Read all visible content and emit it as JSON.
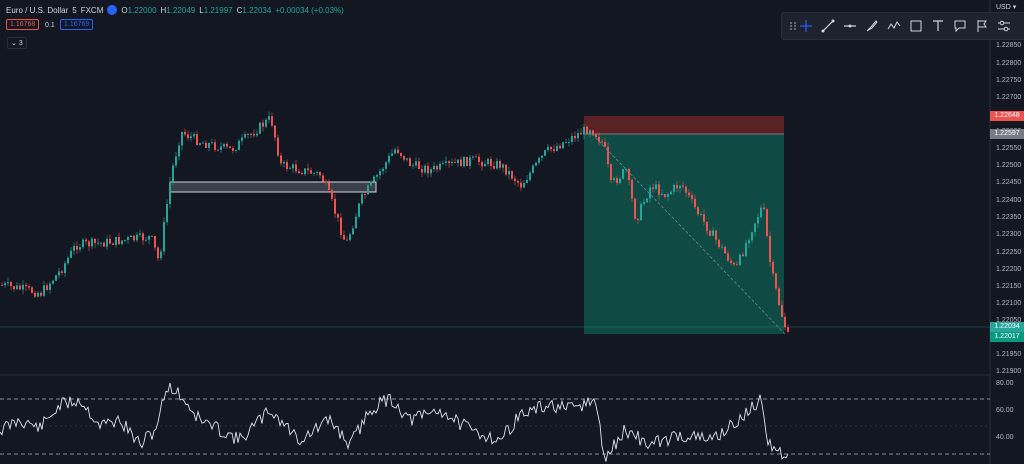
{
  "header": {
    "symbol": "Euro / U.S. Dollar",
    "interval": "5",
    "exchange": "FXCM",
    "open_label": "O",
    "open": "1.22000",
    "high_label": "H",
    "high": "1.22049",
    "low_label": "L",
    "low": "1.21997",
    "close_label": "C",
    "close": "1.22034",
    "change": "+0.00034 (+0.03%)"
  },
  "trade": {
    "sell_price": "1.16768",
    "spread": "0.1",
    "buy_price": "1.16769"
  },
  "indicator_toggle": "3",
  "currency_select": "USD",
  "toolbar_icons": [
    "drag-handle-icon",
    "crosshair-icon",
    "trend-line-icon",
    "horizontal-line-icon",
    "brush-icon",
    "pattern-icon",
    "rectangle-icon",
    "text-icon",
    "callout-icon",
    "flag-icon",
    "settings-icon"
  ],
  "price_axis": {
    "ticks": [
      "1.22850",
      "1.22800",
      "1.22750",
      "1.22700",
      "1.22600",
      "1.22550",
      "1.22500",
      "1.22450",
      "1.22400",
      "1.22350",
      "1.22300",
      "1.22250",
      "1.22200",
      "1.22150",
      "1.22100",
      "1.22050",
      "1.21950",
      "1.21900"
    ],
    "labels": [
      {
        "text": "1.22648",
        "color": "#ef5350"
      },
      {
        "text": "1.22597",
        "color": "#787b86"
      },
      {
        "text": "1.22034",
        "color": "#26a69a"
      },
      {
        "text": "1.22017",
        "color": "#089981"
      }
    ]
  },
  "rsi_axis": {
    "ticks": [
      "80.00",
      "60.00",
      "40.00"
    ]
  },
  "colors": {
    "up": "#26a69a",
    "down": "#ef5350",
    "background": "#131722",
    "profit_zone": "#0f4a45",
    "stop_zone": "#5a2225"
  },
  "chart_data": {
    "type": "candlestick",
    "price_range": [
      1.219,
      1.2285
    ],
    "position": {
      "side": "short",
      "entry": 1.22597,
      "stop": 1.22648,
      "target": 1.22017
    },
    "rsi_levels": [
      70,
      30
    ],
    "rsi_range": [
      25,
      85
    ],
    "consolidation_box": {
      "top": 1.2245,
      "bottom": 1.22437
    }
  }
}
